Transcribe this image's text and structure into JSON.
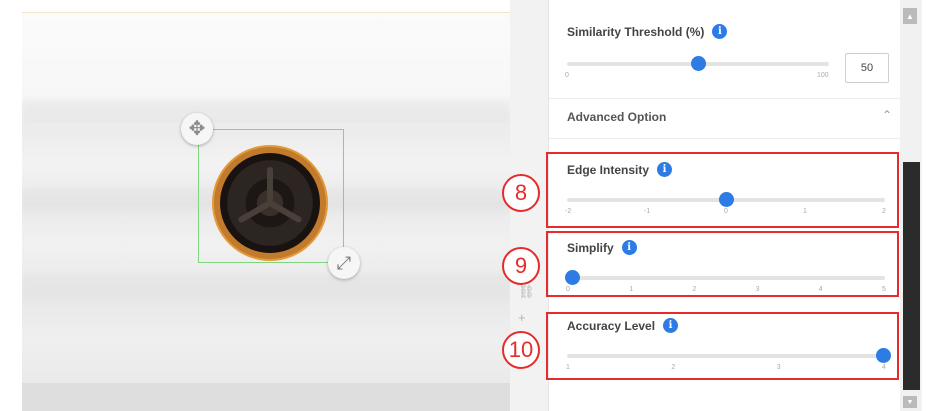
{
  "viewer": {
    "move_handle_icon": "move-arrows-icon",
    "resize_handle_icon": "resize-diagonal-icon",
    "roi_color": "#7fd67f",
    "part_ring_color": "#e39a3b"
  },
  "panel": {
    "similarity": {
      "label": "Similarity Threshold (%)",
      "min_label": "0",
      "max_label": "100",
      "value": "50",
      "fraction": 0.5
    },
    "advanced": {
      "title": "Advanced Option",
      "chevron": "⌃"
    },
    "edge_intensity": {
      "label": "Edge Intensity",
      "ticks": [
        "-2",
        "-1",
        "0",
        "1",
        "2"
      ],
      "fraction": 0.5,
      "callout": "8"
    },
    "simplify": {
      "label": "Simplify",
      "ticks": [
        "0",
        "1",
        "2",
        "3",
        "4",
        "5"
      ],
      "fraction": 0.0,
      "callout": "9"
    },
    "accuracy_level": {
      "label": "Accuracy Level",
      "ticks": [
        "1",
        "2",
        "3",
        "4"
      ],
      "fraction": 1.0,
      "callout": "10"
    }
  },
  "colors": {
    "accent": "#2d7be5",
    "callout": "#e52b2b"
  }
}
